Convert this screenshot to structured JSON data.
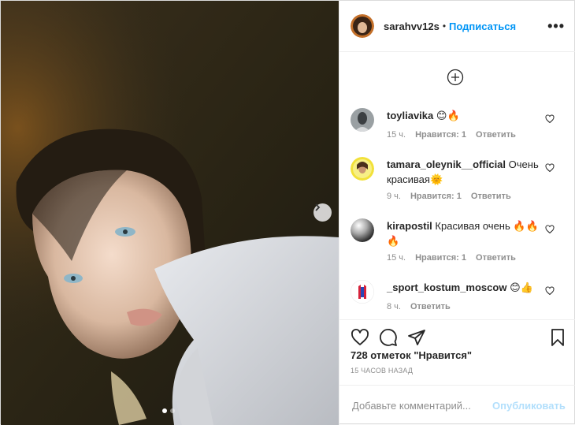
{
  "header": {
    "username": "sarahvv12s",
    "separator": "•",
    "follow_label": "Подписаться",
    "more_icon": "more-options-icon",
    "more_label": "•••"
  },
  "photo": {
    "carousel_total": 2,
    "carousel_active": 1,
    "next_icon": "chevron-right-icon"
  },
  "comments": {
    "load_more_icon": "plus-circle-icon",
    "items": [
      {
        "username": "toyliavika",
        "text": "😊🔥",
        "time": "15 ч.",
        "likes": "Нравится: 1",
        "reply": "Ответить"
      },
      {
        "username": "tamara_oleynik__official",
        "text": "Очень красивая🌞",
        "time": "9 ч.",
        "likes": "Нравится: 1",
        "reply": "Ответить"
      },
      {
        "username": "kirapostil",
        "text": "Красивая очень 🔥🔥🔥",
        "time": "15 ч.",
        "likes": "Нравится: 1",
        "reply": "Ответить"
      },
      {
        "username": "_sport_kostum_moscow",
        "text": "😊👍",
        "time": "8 ч.",
        "likes": "",
        "reply": "Ответить"
      }
    ]
  },
  "actions": {
    "icons": [
      "heart-icon",
      "comment-icon",
      "share-icon",
      "bookmark-icon"
    ],
    "likes_text": "728 отметок \"Нравится\"",
    "time_text": "15 ЧАСОВ НАЗАД"
  },
  "add_comment": {
    "placeholder": "Добавьте комментарий...",
    "value": "",
    "publish_label": "Опубликовать"
  },
  "colors": {
    "accent": "#0095f6",
    "publish_disabled": "#b2dffc",
    "muted": "#8e8e8e"
  }
}
